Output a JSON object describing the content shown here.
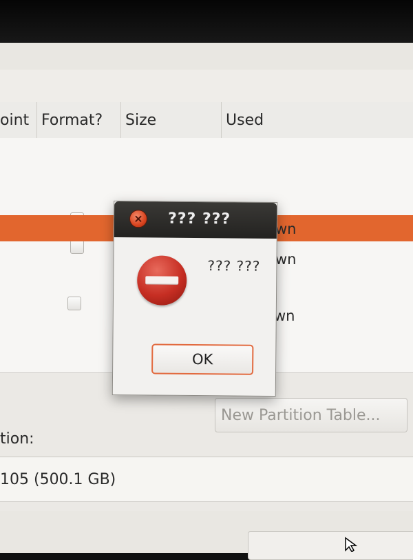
{
  "partition_table": {
    "columns": [
      "oint",
      "Format?",
      "Size",
      "Used"
    ],
    "rows": [
      {
        "used": "wn",
        "format_checked": false
      },
      {
        "used": "wn",
        "format_checked": false
      },
      {
        "used": "",
        "format_checked": false,
        "selected": true
      },
      {
        "used": "wn",
        "format_checked": false
      }
    ]
  },
  "buttons": {
    "new_partition_table": "New Partition Table..."
  },
  "bootloader": {
    "label": "tion:",
    "device_value": "105 (500.1 GB)"
  },
  "dialog": {
    "title": "???  ???",
    "message": "??? ???",
    "ok_label": "OK",
    "icon": "error-icon"
  },
  "colors": {
    "selection": "#e2662e",
    "titlebar": "#2b4464",
    "dialog_title": "#2e2d2a",
    "ok_border": "#e26a3f"
  }
}
